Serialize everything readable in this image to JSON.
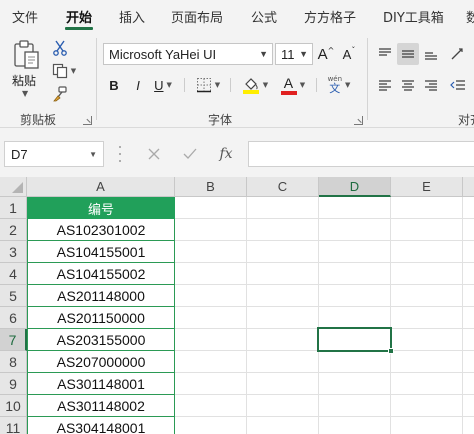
{
  "ribbon_tabs": [
    "文件",
    "开始",
    "插入",
    "页面布局",
    "公式",
    "方方格子",
    "DIY工具箱",
    "数"
  ],
  "active_tab": "开始",
  "clipboard_group": {
    "label": "剪贴板",
    "paste_label": "粘贴"
  },
  "font_group": {
    "label": "字体",
    "font_name": "Microsoft YaHei UI",
    "font_size": "11",
    "grow_font": "A",
    "shrink_font": "A",
    "bold": "B",
    "italic": "I",
    "underline": "U",
    "font_color_letter": "A",
    "phonetic_top": "wén",
    "phonetic_bottom": "文"
  },
  "alignment_group": {
    "label": "对齐"
  },
  "formula_bar": {
    "name_box": "D7",
    "fx_label": "fx",
    "formula_value": ""
  },
  "colors": {
    "accent": "#217346",
    "header_fill": "#21a05a",
    "font_color_bar": "#e02020",
    "highlight_bar": "#ffee00"
  },
  "sheet": {
    "columns": [
      "A",
      "B",
      "C",
      "D",
      "E"
    ],
    "rows": [
      "1",
      "2",
      "3",
      "4",
      "5",
      "6",
      "7",
      "8",
      "9",
      "10",
      "11"
    ],
    "selected_column": "D",
    "selected_row": "7",
    "cells_a": [
      "编号",
      "AS102301002",
      "AS104155001",
      "AS104155002",
      "AS201148000",
      "AS201150000",
      "AS203155000",
      "AS207000000",
      "AS301148001",
      "AS301148002",
      "AS304148001"
    ]
  }
}
